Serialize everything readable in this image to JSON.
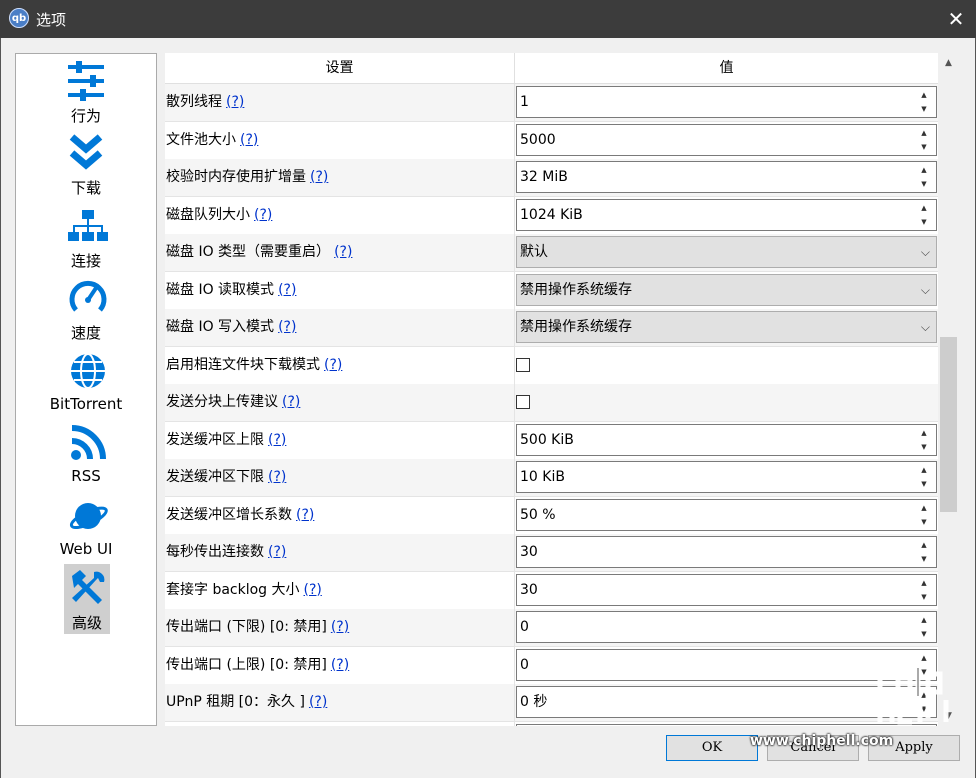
{
  "window": {
    "title": "选项",
    "app_icon": "qb",
    "close_glyph": "✕"
  },
  "sidebar": {
    "items": [
      {
        "label": "行为",
        "icon": "sliders-icon"
      },
      {
        "label": "下载",
        "icon": "double-chevron-down-icon"
      },
      {
        "label": "连接",
        "icon": "network-icon"
      },
      {
        "label": "速度",
        "icon": "speedometer-icon"
      },
      {
        "label": "BitTorrent",
        "icon": "globe-icon"
      },
      {
        "label": "RSS",
        "icon": "rss-icon"
      },
      {
        "label": "Web UI",
        "icon": "planet-icon"
      },
      {
        "label": "高级",
        "icon": "tools-icon",
        "selected": true
      }
    ]
  },
  "table": {
    "headers": {
      "setting": "设置",
      "value": "值"
    },
    "help_text": "(?)",
    "rows": [
      {
        "name": "散列线程",
        "type": "spin",
        "value": "1"
      },
      {
        "name": "文件池大小",
        "type": "spin",
        "value": "5000"
      },
      {
        "name": "校验时内存使用扩增量",
        "type": "spin",
        "value": "32 MiB"
      },
      {
        "name": "磁盘队列大小",
        "type": "spin",
        "value": "1024 KiB"
      },
      {
        "name": "磁盘 IO 类型（需要重启）",
        "type": "combo",
        "value": "默认"
      },
      {
        "name": "磁盘 IO 读取模式",
        "type": "combo",
        "value": "禁用操作系统缓存"
      },
      {
        "name": "磁盘 IO 写入模式",
        "type": "combo",
        "value": "禁用操作系统缓存"
      },
      {
        "name": "启用相连文件块下载模式",
        "type": "check",
        "checked": false
      },
      {
        "name": "发送分块上传建议",
        "type": "check",
        "checked": false
      },
      {
        "name": "发送缓冲区上限",
        "type": "spin",
        "value": "500 KiB"
      },
      {
        "name": "发送缓冲区下限",
        "type": "spin",
        "value": "10 KiB"
      },
      {
        "name": "发送缓冲区增长系数",
        "type": "spin",
        "value": "50 %"
      },
      {
        "name": "每秒传出连接数",
        "type": "spin",
        "value": "30"
      },
      {
        "name": "套接字 backlog 大小",
        "type": "spin",
        "value": "30"
      },
      {
        "name": "传出端口 (下限) [0: 禁用]",
        "type": "spin",
        "value": "0"
      },
      {
        "name": "传出端口 (上限) [0: 禁用]",
        "type": "spin",
        "value": "0"
      },
      {
        "name": "UPnP 租期 [0：永久 ]",
        "type": "spin",
        "value": "0 秒"
      },
      {
        "name": "",
        "type": "spin",
        "value": ""
      }
    ]
  },
  "scrollbar": {
    "position": 0.45
  },
  "buttons": {
    "ok": "OK",
    "cancel": "Cancel",
    "apply": "Apply"
  },
  "watermark": {
    "url": "www.chiphell.com",
    "logo": "chip hell"
  },
  "colors": {
    "titlebar": "#3c3c3c",
    "link": "#0033cc",
    "icon_blue": "#0078d7"
  }
}
